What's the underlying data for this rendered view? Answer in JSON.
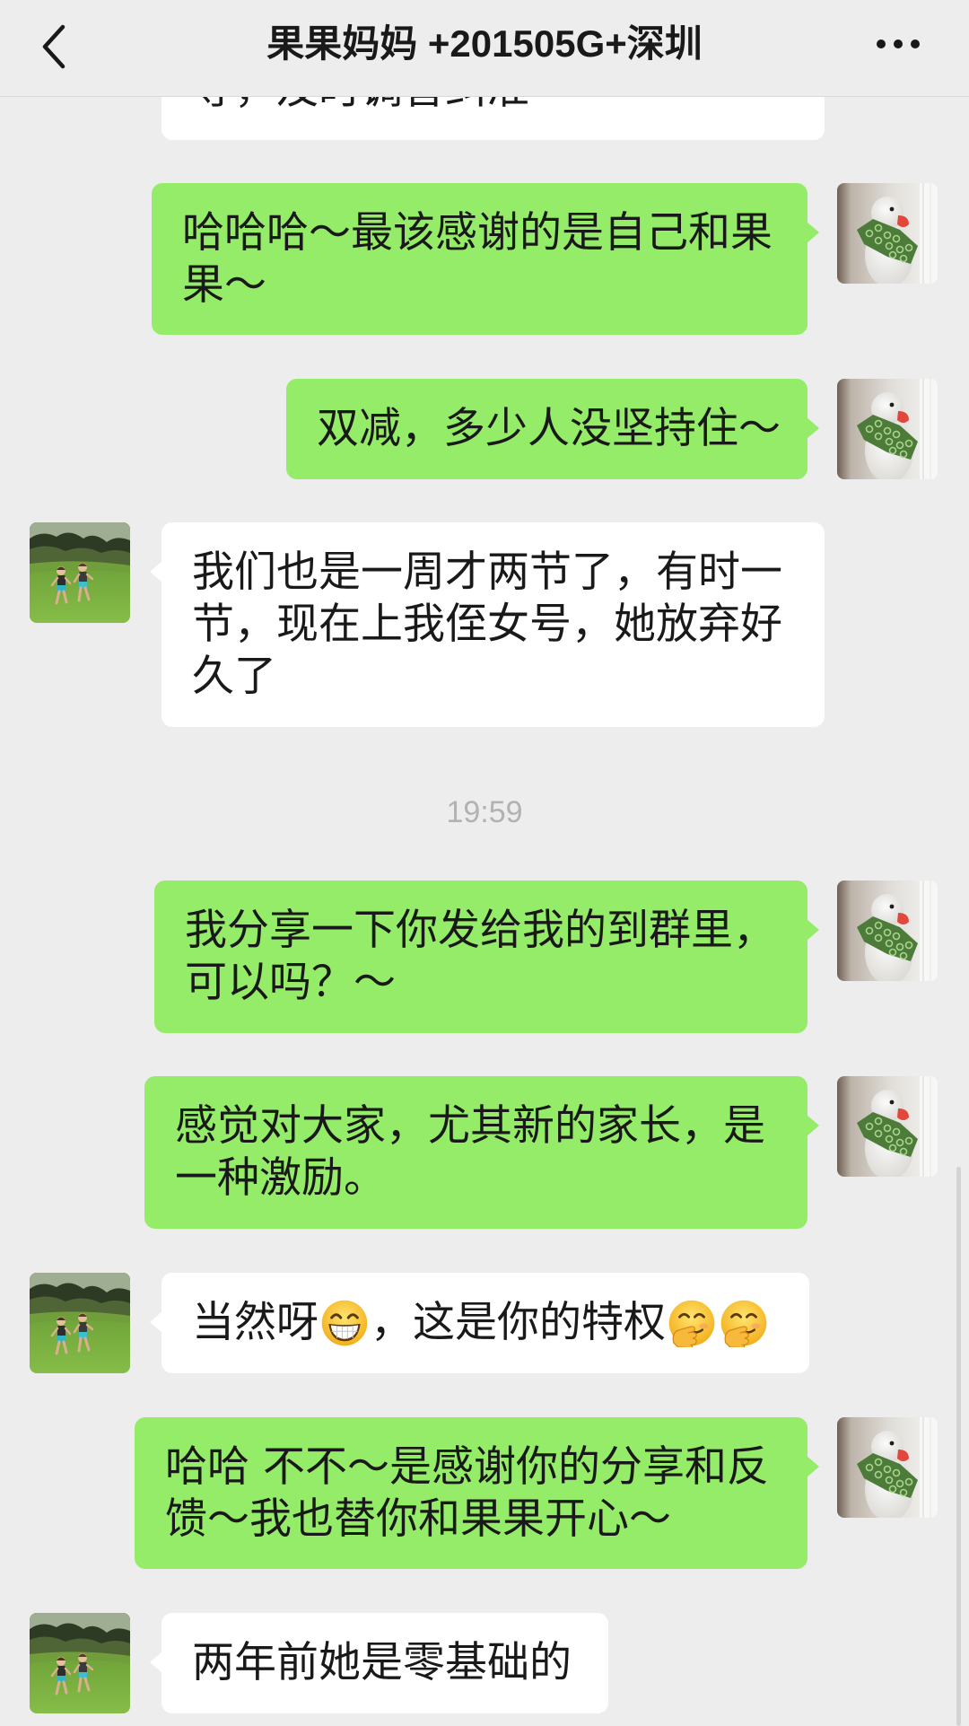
{
  "header": {
    "back_icon": "chevron-left-icon",
    "title": "果果妈妈 +201505G+深圳",
    "more_icon": "more-dots-icon"
  },
  "colors": {
    "background": "#ededed",
    "outgoing_bubble": "#95ec69",
    "incoming_bubble": "#ffffff",
    "timestamp": "#b2b2b2",
    "text": "#191919"
  },
  "messages": [
    {
      "outgoing": false,
      "clipped": true,
      "lines": [
        "导，及时调音纠准"
      ]
    },
    {
      "outgoing": true,
      "lines": [
        "哈哈哈～最该感谢的是自己和果",
        "果～"
      ]
    },
    {
      "outgoing": true,
      "lines": [
        "双减，多少人没坚持住～"
      ]
    },
    {
      "outgoing": false,
      "lines": [
        "我们也是一周才两节了，有时一",
        "节，现在上我侄女号，她放弃好",
        "久了"
      ]
    },
    {
      "time": "19:59"
    },
    {
      "outgoing": true,
      "lines": [
        "我分享一下你发给我的到群里，",
        "可以吗？～"
      ]
    },
    {
      "outgoing": true,
      "lines": [
        "感觉对大家，尤其新的家长，是",
        "一种激励。"
      ]
    },
    {
      "outgoing": false,
      "parts": [
        {
          "text": "当然呀"
        },
        {
          "icon": "grinning-face-with-smiling-eyes-icon"
        },
        {
          "text": "，这是你的特权"
        },
        {
          "icon": "face-with-hand-over-mouth-icon"
        },
        {
          "icon": "face-with-hand-over-mouth-icon"
        }
      ]
    },
    {
      "outgoing": true,
      "lines": [
        "哈哈 不不～是感谢你的分享和反",
        "馈～我也替你和果果开心～"
      ]
    },
    {
      "outgoing": false,
      "lines": [
        "两年前她是零基础的"
      ]
    }
  ]
}
